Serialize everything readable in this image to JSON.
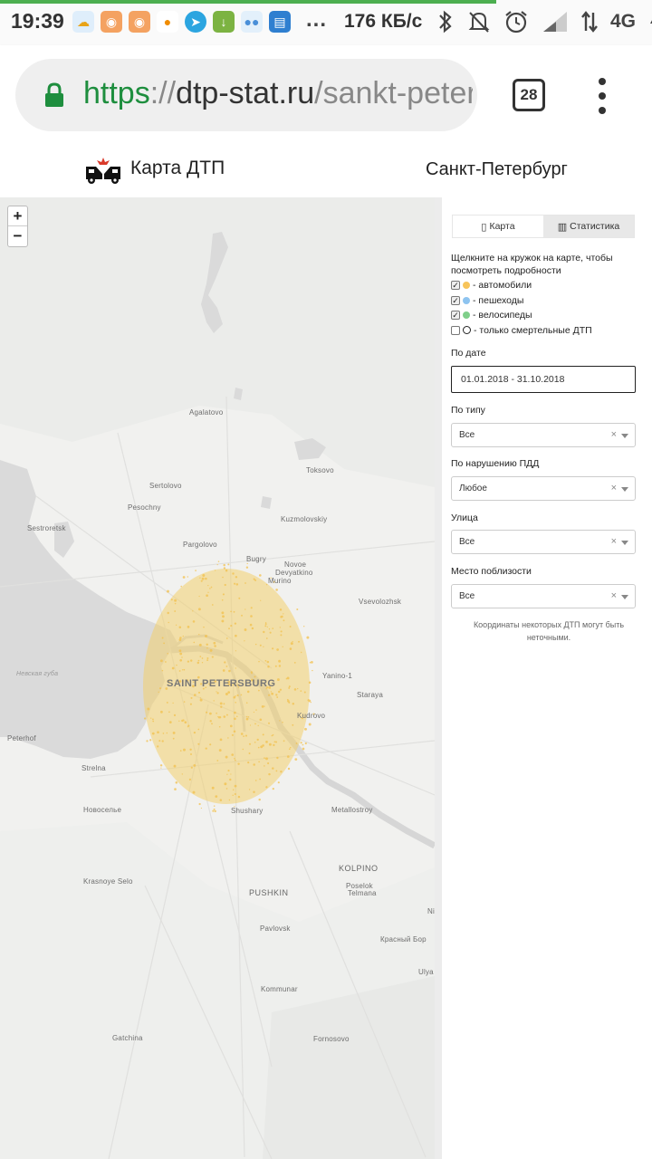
{
  "status_bar": {
    "time": "19:39",
    "overflow_dots": "...",
    "speed": "176 КБ/с",
    "network": "4G",
    "notification_icons": [
      "weather-icon",
      "owl-app-icon",
      "owl-app-icon",
      "ok-app-icon",
      "telegram-icon",
      "download-icon",
      "contacts-icon",
      "sim-toolkit-icon"
    ],
    "system_icons": [
      "bluetooth-icon",
      "mute-icon",
      "alarm-icon",
      "signal-icon",
      "data-arrows-icon",
      "charging-icon"
    ]
  },
  "browser": {
    "url_scheme": "https",
    "url_sep": "://",
    "url_domain": "dtp-stat.ru",
    "url_path": "/sankt-peterburg",
    "tab_count": "28"
  },
  "header": {
    "title": "Карта ДТП",
    "city": "Санкт-Петербург"
  },
  "map": {
    "zoom_in": "+",
    "zoom_out": "−",
    "labels": {
      "agalatovo": "Agalatovo",
      "toksovo": "Toksovo",
      "sertolovo": "Sertolovo",
      "pesochny": "Pesochny",
      "sestroretsk": "Sestroretsk",
      "kuzmolovskiy": "Kuzmolovskiy",
      "pargolovo": "Pargolovo",
      "bugry": "Bugry",
      "novoe": "Novoe",
      "devyatkino": "Devyatkino",
      "murino": "Murino",
      "vsevolozhsk": "Vsevolozhsk",
      "saint_petersburg": "SAINT PETERSBURG",
      "yanino": "Yanino-1",
      "staraya": "Staraya",
      "kudrovo": "Kudrovo",
      "gulf": "Невская губа",
      "peterhof": "Peterhof",
      "strelna": "Strelna",
      "novoselye": "Новоселье",
      "shushary": "Shushary",
      "metallostroy": "Metallostroy",
      "krasnoye_selo": "Krasnoye Selo",
      "pushkin": "PUSHKIN",
      "kolpino": "KOLPINO",
      "poselok_telmana": "Poselok",
      "telmana": "Telmana",
      "pavlovsk": "Pavlovsk",
      "krasny_bor": "Красный Бор",
      "kommunar": "Kommunar",
      "gatchina": "Gatchina",
      "fornosovo": "Fornosovo",
      "ulya": "Ulya",
      "ni": "Ni"
    }
  },
  "panel": {
    "tab_map": "Карта",
    "tab_stats": "Статистика",
    "hint": "Щелкните на кружок на карте, чтобы посмотреть подробности",
    "legend": [
      {
        "label": "- автомобили",
        "color": "#f7c45a",
        "checked": true
      },
      {
        "label": "- пешеходы",
        "color": "#8ec4f0",
        "checked": true
      },
      {
        "label": "- велосипеды",
        "color": "#7fcf8a",
        "checked": true
      },
      {
        "label": "- только смертельные ДТП",
        "color": "ring",
        "checked": false
      }
    ],
    "by_date_label": "По дате",
    "date_range": "01.01.2018 - 31.10.2018",
    "by_type_label": "По типу",
    "by_type_value": "Все",
    "by_violation_label": "По нарушению ПДД",
    "by_violation_value": "Любое",
    "street_label": "Улица",
    "street_value": "Все",
    "nearby_label": "Место поблизости",
    "nearby_value": "Все",
    "clear_symbol": "×",
    "note": "Координаты некоторых ДТП могут быть неточными."
  }
}
